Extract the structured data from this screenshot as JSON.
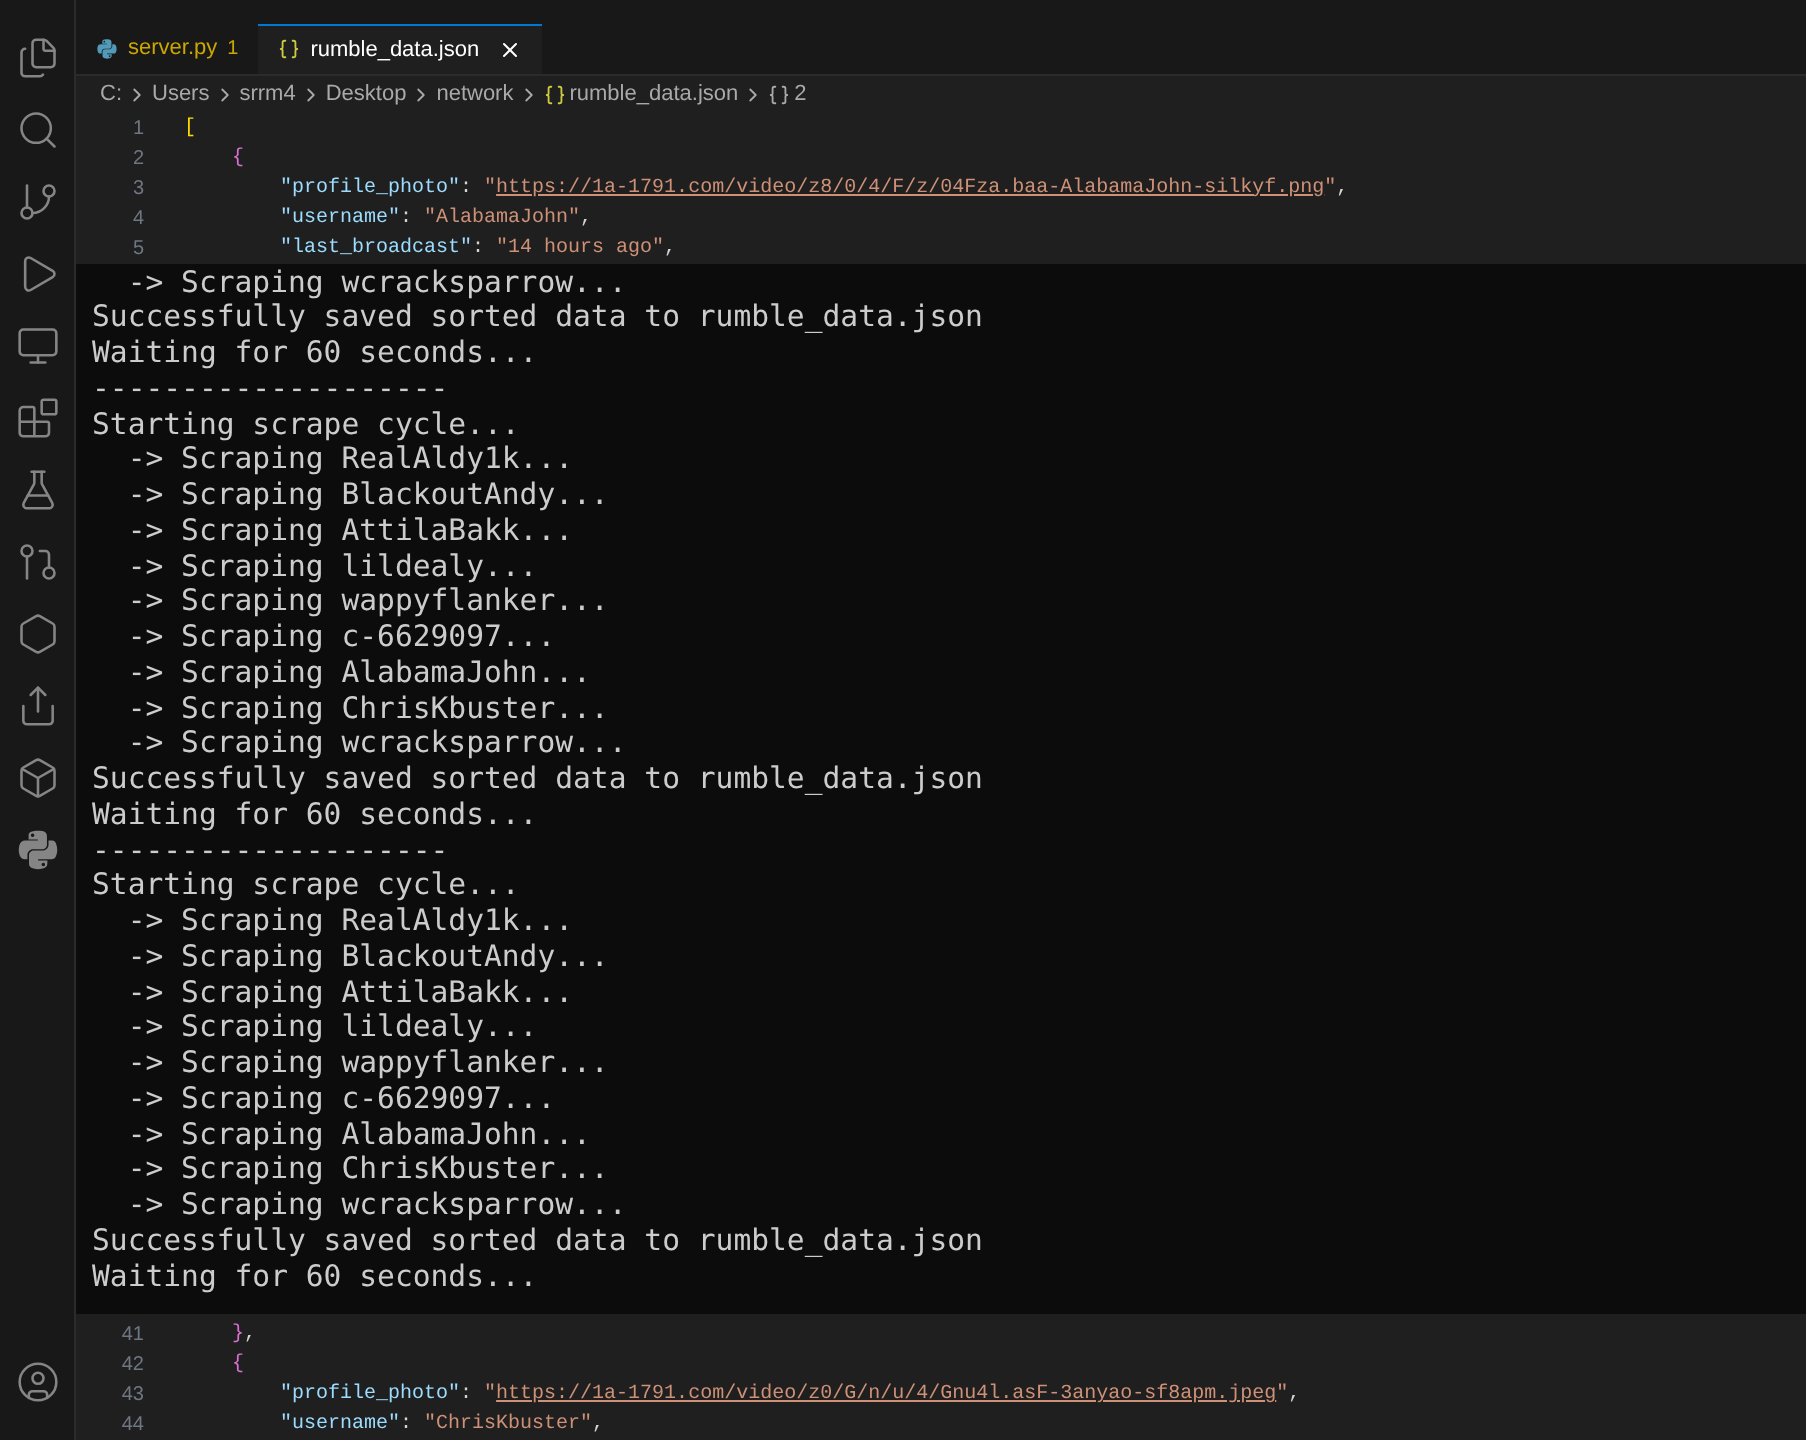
{
  "tabs": [
    {
      "label": "server.py",
      "kind": "python",
      "problems": "1",
      "selected": false
    },
    {
      "label": "rumble_data.json",
      "kind": "json",
      "selected": true
    }
  ],
  "breadcrumb": [
    {
      "kind": "text",
      "text": "C:"
    },
    {
      "kind": "text",
      "text": "Users"
    },
    {
      "kind": "text",
      "text": "srrm4"
    },
    {
      "kind": "text",
      "text": "Desktop"
    },
    {
      "kind": "text",
      "text": "network"
    },
    {
      "kind": "json",
      "text": "rumble_data.json"
    },
    {
      "kind": "object",
      "text": "2"
    }
  ],
  "editor_top": [
    {
      "number": "1",
      "kind": "array",
      "tokens": [
        {
          "kind": "bracket1",
          "text": "["
        }
      ]
    },
    {
      "number": "2",
      "kind": "object",
      "tokens": [
        {
          "kind": "bracket2",
          "text": "{"
        }
      ]
    },
    {
      "number": "3",
      "kind": "property",
      "tokens": [
        {
          "kind": "key",
          "text": "\"profile_photo\""
        },
        {
          "kind": "punct",
          "text": ": "
        },
        {
          "kind": "string",
          "text": "\""
        },
        {
          "kind": "link",
          "text": "https://1a-1791.com/video/z8/0/4/F/z/04Fza.baa-AlabamaJohn-silkyf.png"
        },
        {
          "kind": "string",
          "text": "\""
        },
        {
          "kind": "punct",
          "text": ","
        }
      ]
    },
    {
      "number": "4",
      "kind": "property",
      "tokens": [
        {
          "kind": "key",
          "text": "\"username\""
        },
        {
          "kind": "punct",
          "text": ": "
        },
        {
          "kind": "string",
          "text": "\"AlabamaJohn\""
        },
        {
          "kind": "punct",
          "text": ","
        }
      ]
    },
    {
      "number": "5",
      "kind": "property",
      "tokens": [
        {
          "kind": "key",
          "text": "\"last_broadcast\""
        },
        {
          "kind": "punct",
          "text": ": "
        },
        {
          "kind": "string",
          "text": "\"14 hours ago\""
        },
        {
          "kind": "punct",
          "text": ","
        }
      ]
    }
  ],
  "terminal": [
    "  -> Scraping wcracksparrow...",
    "Successfully saved sorted data to rumble_data.json",
    "Waiting for 60 seconds...",
    "--------------------",
    "Starting scrape cycle...",
    "  -> Scraping RealAldy1k...",
    "  -> Scraping BlackoutAndy...",
    "  -> Scraping AttilaBakk...",
    "  -> Scraping lildealy...",
    "  -> Scraping wappyflanker...",
    "  -> Scraping c-6629097...",
    "  -> Scraping AlabamaJohn...",
    "  -> Scraping ChrisKbuster...",
    "  -> Scraping wcracksparrow...",
    "Successfully saved sorted data to rumble_data.json",
    "Waiting for 60 seconds...",
    "--------------------",
    "Starting scrape cycle...",
    "  -> Scraping RealAldy1k...",
    "  -> Scraping BlackoutAndy...",
    "  -> Scraping AttilaBakk...",
    "  -> Scraping lildealy...",
    "  -> Scraping wappyflanker...",
    "  -> Scraping c-6629097...",
    "  -> Scraping AlabamaJohn...",
    "  -> Scraping ChrisKbuster...",
    "  -> Scraping wcracksparrow...",
    "Successfully saved sorted data to rumble_data.json",
    "Waiting for 60 seconds..."
  ],
  "editor_bottom": [
    {
      "number": "41",
      "kind": "object",
      "tokens": [
        {
          "kind": "bracket2",
          "text": "}"
        },
        {
          "kind": "punct",
          "text": ","
        }
      ]
    },
    {
      "number": "42",
      "kind": "object",
      "tokens": [
        {
          "kind": "bracket2",
          "text": "{"
        }
      ]
    },
    {
      "number": "43",
      "kind": "property",
      "tokens": [
        {
          "kind": "key",
          "text": "\"profile_photo\""
        },
        {
          "kind": "punct",
          "text": ": "
        },
        {
          "kind": "string",
          "text": "\""
        },
        {
          "kind": "link",
          "text": "https://1a-1791.com/video/z0/G/n/u/4/Gnu4l.asF-3anyao-sf8apm.jpeg"
        },
        {
          "kind": "string",
          "text": "\""
        },
        {
          "kind": "punct",
          "text": ","
        }
      ]
    },
    {
      "number": "44",
      "kind": "property",
      "tokens": [
        {
          "kind": "key",
          "text": "\"username\""
        },
        {
          "kind": "punct",
          "text": ": "
        },
        {
          "kind": "string",
          "text": "\"ChrisKbuster\""
        },
        {
          "kind": "punct",
          "text": ","
        }
      ]
    }
  ]
}
